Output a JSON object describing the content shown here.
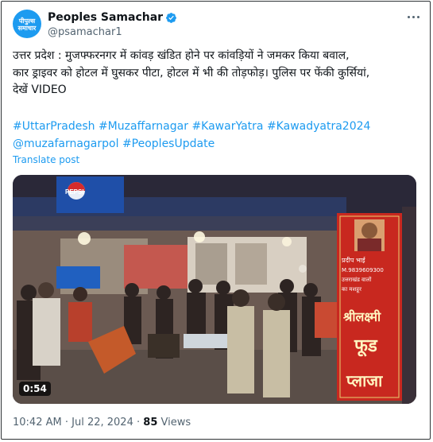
{
  "author": {
    "name": "Peoples Samachar",
    "handle": "@psamachar1",
    "avatar_text_line1": "पीपुल्स",
    "avatar_text_line2": "समाचार",
    "verified_icon": "verified-badge"
  },
  "post": {
    "line1": "उत्तर प्रदेश : मुजफ्फरनगर में कांवड़ खंडित होने पर कांवड़ियों ने जमकर किया बवाल,",
    "line2": "कार ड्राइवर को होटल में घुसकर पीटा, होटल में भी की तोड़फोड़। पुलिस पर फेंकी कुर्सियां,",
    "line3": "देखें VIDEO",
    "hashtags_line1": [
      "#UttarPradesh",
      "#Muzaffarnagar",
      "#KawarYatra",
      "#Kawadyatra2024"
    ],
    "hashtags_line2": [
      "@muzafarnagarpol",
      "#PeoplesUpdate"
    ],
    "translate_label": "Translate post"
  },
  "video": {
    "duration": "0:54",
    "pepsi_text": "PEPSI",
    "sign_phone": "M.9839609300",
    "sign_line_small1": "प्रदीप भाई",
    "sign_line_small2": "उत्तराखंड वालों",
    "sign_line_small3": "का मशहूर",
    "sign_line1": "श्रीलक्ष्मी",
    "sign_line2": "फूड",
    "sign_line3": "प्लाजा"
  },
  "meta": {
    "time": "10:42 AM",
    "date": "Jul 22, 2024",
    "separator": "·",
    "views_count": "85",
    "views_label": "Views"
  }
}
